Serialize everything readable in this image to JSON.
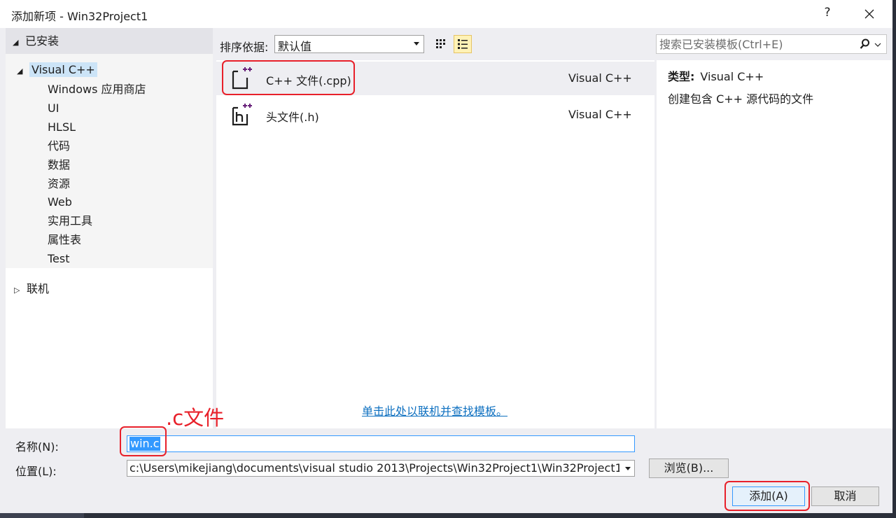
{
  "title": {
    "text": "添加新项 - Win32Project1",
    "help": "?"
  },
  "tree": {
    "installed": "已安装",
    "visual_cpp": "Visual C++",
    "children": [
      "Windows 应用商店",
      "UI",
      "HLSL",
      "代码",
      "数据",
      "资源",
      "Web",
      "实用工具",
      "属性表",
      "Test"
    ],
    "online": "联机"
  },
  "toolbar": {
    "sort_label": "排序依据:",
    "sort_value": "默认值"
  },
  "search": {
    "placeholder": "搜索已安装模板(Ctrl+E)"
  },
  "templates": [
    {
      "name": "C++ 文件(.cpp)",
      "lang": "Visual C++",
      "icon": "cpp-file-icon"
    },
    {
      "name": "头文件(.h)",
      "lang": "Visual C++",
      "icon": "header-file-icon"
    }
  ],
  "online_link": "单击此处以联机并查找模板。",
  "details": {
    "type_label": "类型:",
    "type_value": "Visual C++",
    "description": "创建包含 C++ 源代码的文件"
  },
  "form": {
    "name_label": "名称(N):",
    "name_value": "win.c",
    "location_label": "位置(L):",
    "location_value": "c:\\Users\\mikejiang\\documents\\visual studio 2013\\Projects\\Win32Project1\\Win32Project1\\",
    "browse": "浏览(B)...",
    "add": "添加(A)",
    "cancel": "取消"
  },
  "annotation": {
    "text": ".c文件"
  },
  "colors": {
    "accent": "#3399ff",
    "annotation": "#e8202a",
    "link": "#0e70c0",
    "selection": "#cce4f7"
  }
}
